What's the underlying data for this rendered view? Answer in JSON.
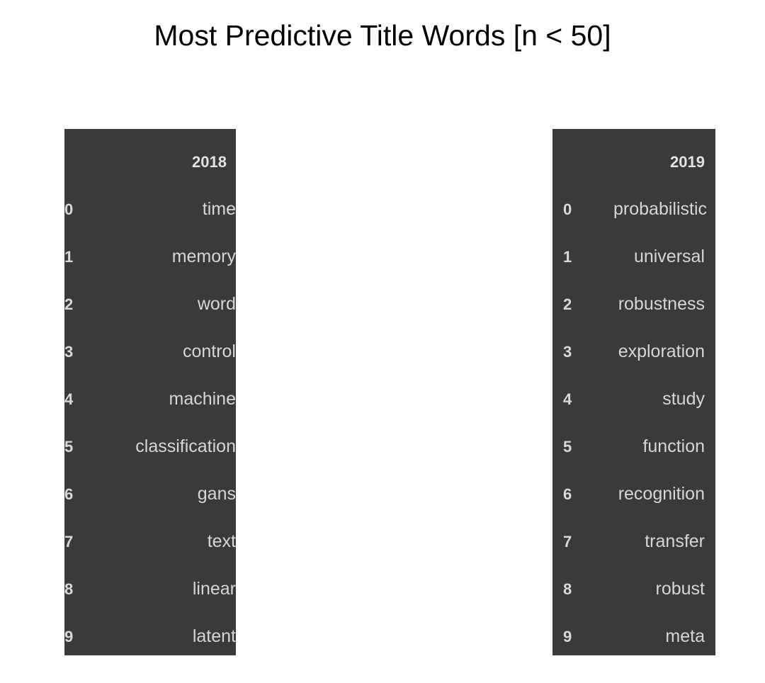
{
  "figure": {
    "title": "Most Predictive Title Words [n < 50]",
    "background_color": "#ffffff",
    "panel_color": "#3a3a3a",
    "text_color": "#d6d6d6",
    "title_color": "#000000"
  },
  "chart_data": {
    "type": "table",
    "title": "Most Predictive Title Words [n < 50]",
    "xlabel": "",
    "ylabel": "",
    "tables": [
      {
        "name": "2018",
        "header": "2018",
        "index_header": "",
        "rows": [
          {
            "index": "0",
            "word": "time"
          },
          {
            "index": "1",
            "word": "memory"
          },
          {
            "index": "2",
            "word": "word"
          },
          {
            "index": "3",
            "word": "control"
          },
          {
            "index": "4",
            "word": "machine"
          },
          {
            "index": "5",
            "word": "classification"
          },
          {
            "index": "6",
            "word": "gans"
          },
          {
            "index": "7",
            "word": "text"
          },
          {
            "index": "8",
            "word": "linear"
          },
          {
            "index": "9",
            "word": "latent"
          }
        ]
      },
      {
        "name": "2019",
        "header": "2019",
        "index_header": "",
        "rows": [
          {
            "index": "0",
            "word": "probabilistic"
          },
          {
            "index": "1",
            "word": "universal"
          },
          {
            "index": "2",
            "word": "robustness"
          },
          {
            "index": "3",
            "word": "exploration"
          },
          {
            "index": "4",
            "word": "study"
          },
          {
            "index": "5",
            "word": "function"
          },
          {
            "index": "6",
            "word": "recognition"
          },
          {
            "index": "7",
            "word": "transfer"
          },
          {
            "index": "8",
            "word": "robust"
          },
          {
            "index": "9",
            "word": "meta"
          }
        ]
      }
    ]
  }
}
